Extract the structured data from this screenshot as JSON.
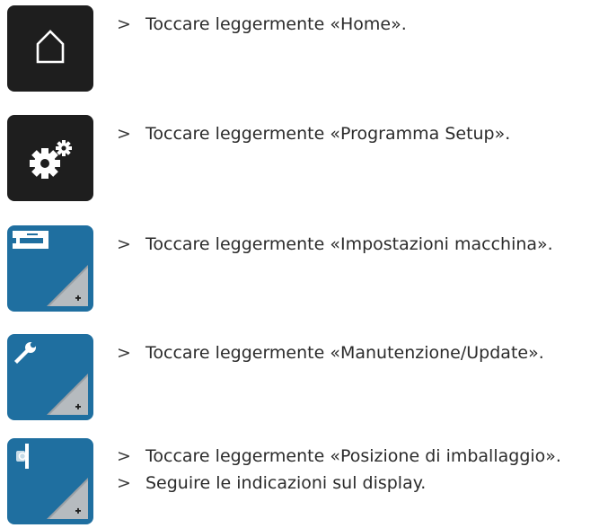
{
  "rows": [
    {
      "icon": "home-icon",
      "steps": [
        "Toccare leggermente «Home»."
      ]
    },
    {
      "icon": "gear-icon",
      "steps": [
        "Toccare leggermente «Programma Setup»."
      ]
    },
    {
      "icon": "sewing-machine-icon",
      "steps": [
        "Toccare leggermente «Impostazioni macchina»."
      ]
    },
    {
      "icon": "wrench-icon",
      "steps": [
        "Toccare leggermente «Manutenzione/Update»."
      ]
    },
    {
      "icon": "packing-position-icon",
      "steps": [
        "Toccare leggermente «Posizione di imballaggio».",
        "Seguire le indicazioni sul display."
      ]
    }
  ],
  "bullet": ">",
  "colors": {
    "dark_tile": "#1e1e1e",
    "blue_tile": "#1f6fa0"
  }
}
